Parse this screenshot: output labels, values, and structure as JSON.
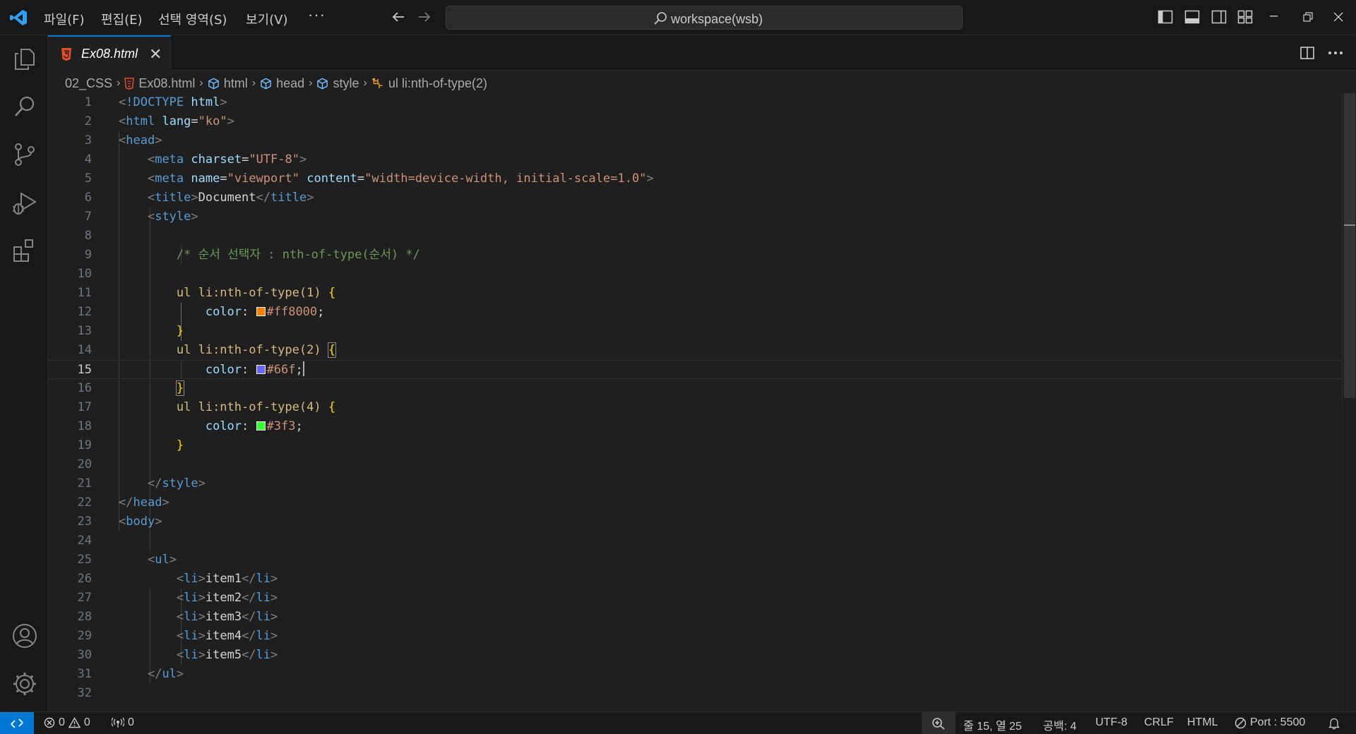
{
  "menu": {
    "file": "파일(F)",
    "edit": "편집(E)",
    "selection": "선택 영역(S)",
    "view": "보기(V)",
    "more": "···"
  },
  "command_center": {
    "text": "workspace(wsb)"
  },
  "tab": {
    "label": "Ex08.html",
    "close": "✕"
  },
  "breadcrumb": {
    "folder": "02_CSS",
    "file": "Ex08.html",
    "html": "html",
    "head": "head",
    "style": "style",
    "selector": "ul li:nth-of-type(2)"
  },
  "editor": {
    "current_line": 15,
    "lines": [
      "1",
      "2",
      "3",
      "4",
      "5",
      "6",
      "7",
      "8",
      "9",
      "10",
      "11",
      "12",
      "13",
      "14",
      "15",
      "16",
      "17",
      "18",
      "19",
      "20",
      "21",
      "22",
      "23",
      "24",
      "25",
      "26",
      "27",
      "28",
      "29",
      "30",
      "31",
      "32"
    ],
    "code": {
      "doctype": "!DOCTYPE",
      "html_kw": "html",
      "html_tag": "html",
      "lang_attr": "lang",
      "lang_val": "\"ko\"",
      "head": "head",
      "meta": "meta",
      "charset_attr": "charset",
      "charset_val": "\"UTF-8\"",
      "name_attr": "name",
      "name_val": "\"viewport\"",
      "content_attr": "content",
      "content_val": "\"width=device-width, initial-scale=1.0\"",
      "title": "title",
      "title_text": "Document",
      "style": "style",
      "comment": "/* 순서 선택자 : nth-of-type(순서) */",
      "sel1": "ul li:nth-of-type(1)",
      "sel2": "ul li:nth-of-type(2)",
      "sel4": "ul li:nth-of-type(4)",
      "color_prop": "color",
      "val1": "#ff8000",
      "val2": "#66f",
      "val4": "#3f3",
      "body": "body",
      "ul": "ul",
      "li": "li",
      "item1": "item1",
      "item2": "item2",
      "item3": "item3",
      "item4": "item4",
      "item5": "item5"
    }
  },
  "status": {
    "errors": "0",
    "warnings": "0",
    "ports": "0",
    "position": "줄 15, 열 25",
    "indent": "공백: 4",
    "encoding": "UTF-8",
    "eol": "CRLF",
    "language": "HTML",
    "live_server": "Port : 5500"
  },
  "colors": {
    "accent": "#0078d4",
    "swatch1": "#ff8000",
    "swatch2": "#6666ff",
    "swatch4": "#33ff33",
    "html_icon": "#e44d26"
  }
}
